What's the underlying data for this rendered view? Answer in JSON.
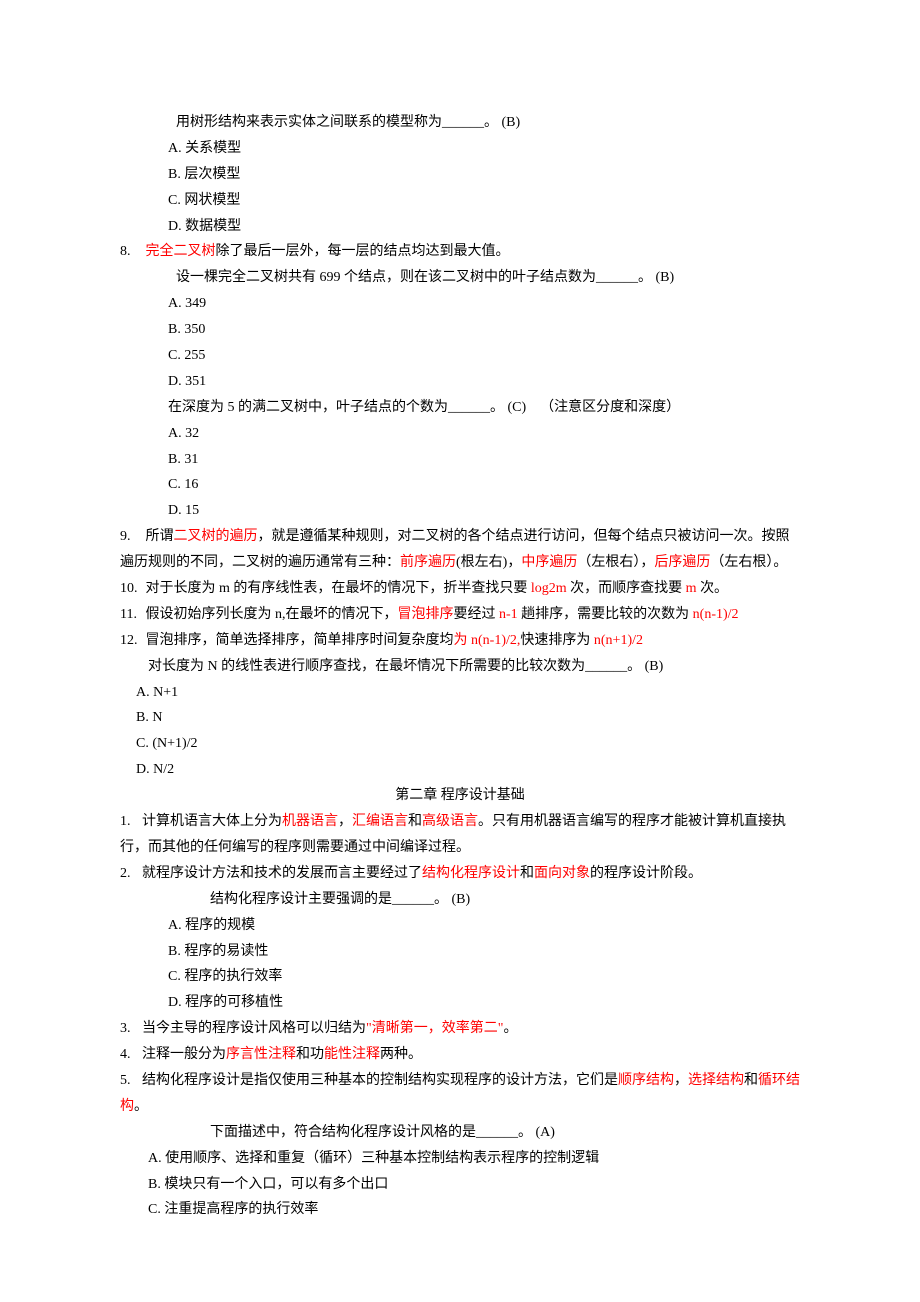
{
  "q7_sub": {
    "stem_pre": "用树形结构来表示实体之间联系的模型称为______。",
    "ans": "(B)",
    "A": "A. 关系模型",
    "B": "B. 层次模型",
    "C": "C. 网状模型",
    "D": "D. 数据模型"
  },
  "q8": {
    "num": "8.",
    "term": "完全二叉树",
    "rest": "除了最后一层外，每一层的结点均达到最大值。",
    "sub1_stem": "设一棵完全二叉树共有 699 个结点，则在该二叉树中的叶子结点数为______。",
    "sub1_ans": "(B)",
    "sub1_A": "A. 349",
    "sub1_B": "B. 350",
    "sub1_C": "C. 255",
    "sub1_D": "D. 351",
    "sub2_stem": "在深度为 5 的满二叉树中，叶子结点的个数为______。",
    "sub2_ans": "(C)",
    "sub2_note": "（注意区分度和深度）",
    "sub2_A": "A. 32",
    "sub2_B": "B. 31",
    "sub2_C": "C. 16",
    "sub2_D": "D. 15"
  },
  "q9": {
    "num": "9.",
    "t1": "所谓",
    "r1": "二叉树的遍历",
    "t2": "，就是遵循某种规则，对二叉树的各个结点进行访问，但每个结点只被访问一次。按照遍历规则的不同，二叉树的遍历通常有三种：",
    "r2": "前序遍历",
    "t3": "(根左右)，",
    "r3": "中序遍历",
    "t4": "（左根右），",
    "r4": "后序遍历",
    "t5": "（左右根）。"
  },
  "q10": {
    "num": "10.",
    "t1": "对于长度为 m 的有序线性表，在最坏的情况下，折半查找只要 ",
    "r1": "log2m",
    "t2": " 次，而顺序查找要 ",
    "r2": "m",
    "t3": " 次。"
  },
  "q11": {
    "num": "11.",
    "t1": "假设初始序列长度为 n,在最坏的情况下，",
    "r1": "冒泡排序",
    "t2": "要经过 ",
    "r2": "n-1",
    "t3": " 趟排序，需要比较的次数为 ",
    "r3": "n(n-1)/2"
  },
  "q12": {
    "num": "12.",
    "t1": "冒泡排序，简单选择排序，简单排序时间复杂度均",
    "r1": "为 n(n-1)/2,",
    "t2": "快速排序为 ",
    "r2": "n(n+1)/2",
    "sub_t": "对长度为 N 的线性表进行顺序查找，在最坏情况下所需要的比较次数为______。",
    "sub_ans": "(B)",
    "A": "A. N+1",
    "B": "B. N",
    "C": "C. (N+1)/2",
    "D": "D. N/2"
  },
  "ch2": {
    "title": "第二章    程序设计基础"
  },
  "c2q1": {
    "num": "1.",
    "t1": "计算机语言大体上分为",
    "r1": "机器语言",
    "t2": "，",
    "r2": "汇编语言",
    "t3": "和",
    "r3": "高级语言",
    "t4": "。只有用机器语言编写的程序才能被计算机直接执行，而其他的任何编写的程序则需要通过中间编译过程。"
  },
  "c2q2": {
    "num": "2.",
    "t1": "就程序设计方法和技术的发展而言主要经过了",
    "r1": "结构化程序设计",
    "t2": "和",
    "r2": "面向对象",
    "t3": "的程序设计阶段。",
    "sub_t": "结构化程序设计主要强调的是______。",
    "sub_ans": "(B)",
    "A": "A. 程序的规模",
    "B": "B. 程序的易读性",
    "C": "C. 程序的执行效率",
    "D": "D. 程序的可移植性"
  },
  "c2q3": {
    "num": "3.",
    "t1": "当今主导的程序设计风格可以归结为",
    "r1": "\"清晰第一，效率第二\"",
    "t2": "。"
  },
  "c2q4": {
    "num": "4.",
    "t1": "注释一般分为",
    "r1": "序言性注释",
    "t2": "和功",
    "r2": "能性注释",
    "t3": "两种。"
  },
  "c2q5": {
    "num": "5.",
    "t1": "结构化程序设计是指仅使用三种基本的控制结构实现程序的设计方法，它们是",
    "r1": "顺序结构",
    "t2": "，",
    "r2": "选择结构",
    "t3": "和",
    "r3": "循环结构",
    "t4": "。",
    "sub_t": "下面描述中，符合结构化程序设计风格的是______。",
    "sub_ans": "(A)",
    "A": "A. 使用顺序、选择和重复（循环）三种基本控制结构表示程序的控制逻辑",
    "B": "B. 模块只有一个入口，可以有多个出口",
    "C": "C. 注重提高程序的执行效率"
  }
}
